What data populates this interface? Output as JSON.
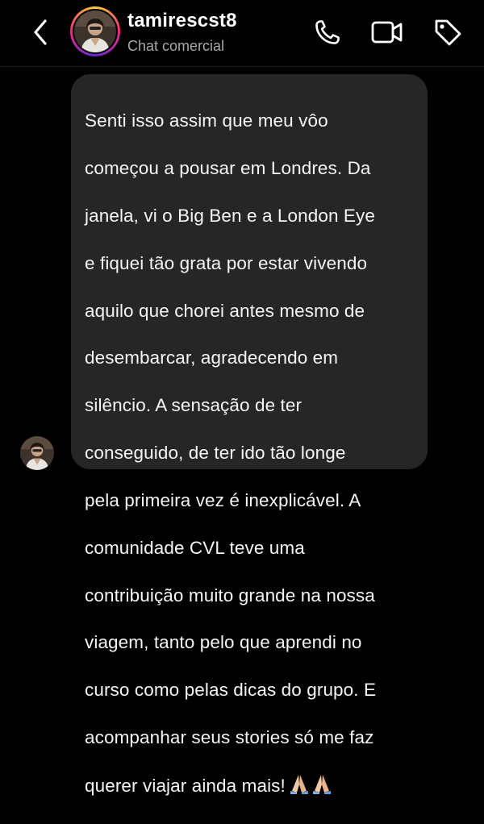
{
  "header": {
    "username": "tamirescst8",
    "subtitle": "Chat comercial",
    "icons": [
      "back-chevron-icon",
      "phone-icon",
      "video-camera-icon",
      "tag-icon"
    ]
  },
  "message": {
    "lines": [
      "Senti isso assim que meu vôo",
      "começou a pousar em Londres. Da",
      "janela, vi o Big Ben e a London Eye",
      "e fiquei tão grata por estar vivendo",
      "aquilo que chorei antes mesmo de",
      "desembarcar, agradecendo em",
      "silêncio. A sensação de ter",
      "conseguido, de ter ido tão longe",
      "pela primeira vez é inexplicável. A",
      "comunidade CVL teve uma",
      "contribuição muito grande na nossa",
      "viagem, tanto pelo que aprendi no",
      "curso como pelas dicas do grupo. E",
      "acompanhar seus stories só me faz"
    ],
    "last_line": "querer viajar ainda mais!",
    "emoji": "praying-hands-icon"
  },
  "colors": {
    "background": "#000000",
    "bubble": "#262626",
    "text": "#f5f5f5",
    "secondary_text": "#a8a8a8"
  }
}
